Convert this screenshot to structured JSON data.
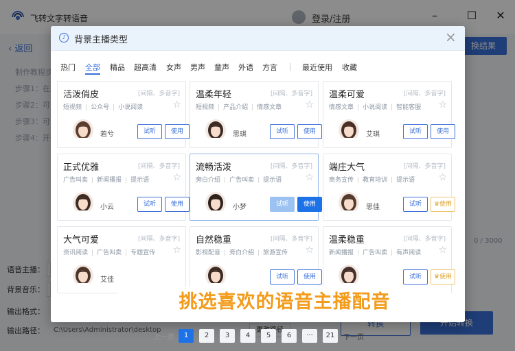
{
  "app": {
    "title": "飞转文字转语音",
    "login": "登录/注册",
    "back": "返回",
    "steps": [
      "制作教程步",
      "步骤1：在左",
      "步骤2：可调",
      "步骤3：可设",
      "步骤4：开始"
    ],
    "result_button": "换结果",
    "counter": "0 / 3000",
    "form": {
      "voice_label": "语音主播：",
      "music_label": "背景音乐：",
      "format_label": "输出格式：",
      "path_label": "输出路径：",
      "path_value": "C:\\Users\\Administrator\\desktop",
      "change_path": "更改路径"
    },
    "bottom_buttons": [
      "转换",
      "开始转换"
    ]
  },
  "modal": {
    "title": "背景主播类型",
    "tabs": [
      "热门",
      "全部",
      "精品",
      "超高清",
      "女声",
      "男声",
      "童声",
      "外语",
      "方言",
      "最近使用",
      "收藏"
    ],
    "active_tab": "全部",
    "hint": "[间隔、多音字]",
    "try_label": "试听",
    "use_label": "使用",
    "cards": [
      {
        "name": "活泼俏皮",
        "tags": [
          "短视频",
          "公众号",
          "小说阅读"
        ],
        "voice": "若兮"
      },
      {
        "name": "温柔年轻",
        "tags": [
          "短视频",
          "产品介绍",
          "情感文章"
        ],
        "voice": "思琪"
      },
      {
        "name": "温柔可爱",
        "tags": [
          "情感文章",
          "小说阅读",
          "智能客服"
        ],
        "voice": "艾琪"
      },
      {
        "name": "正式优雅",
        "tags": [
          "广告叫卖",
          "新闻播报",
          "提示语"
        ],
        "voice": "小云"
      },
      {
        "name": "流畅活泼",
        "tags": [
          "旁白介绍",
          "广告叫卖",
          "提示语"
        ],
        "voice": "小梦"
      },
      {
        "name": "端庄大气",
        "tags": [
          "商务宣传",
          "教育培训",
          "提示语"
        ],
        "voice": "思佳"
      },
      {
        "name": "大气可爱",
        "tags": [
          "资讯阅读",
          "广告叫卖",
          "专题宣传"
        ],
        "voice": "艾佳"
      },
      {
        "name": "自然稳重",
        "tags": [
          "影视配音",
          "旁白介绍",
          "旅游宣传"
        ],
        "voice": ""
      },
      {
        "name": "温柔稳重",
        "tags": [
          "新闻播报",
          "广告叫卖",
          "有声阅读"
        ],
        "voice": ""
      }
    ],
    "banner": "挑选喜欢的语音主播配音",
    "pagination": {
      "prev": "上一页",
      "pages": [
        "1",
        "2",
        "3",
        "4",
        "5",
        "6",
        "···",
        "21"
      ],
      "next": "下一页",
      "current": "1"
    }
  },
  "colors": {
    "accent": "#3a6fd8",
    "banner": "#f39b1a",
    "vip": "#e0a32f"
  }
}
